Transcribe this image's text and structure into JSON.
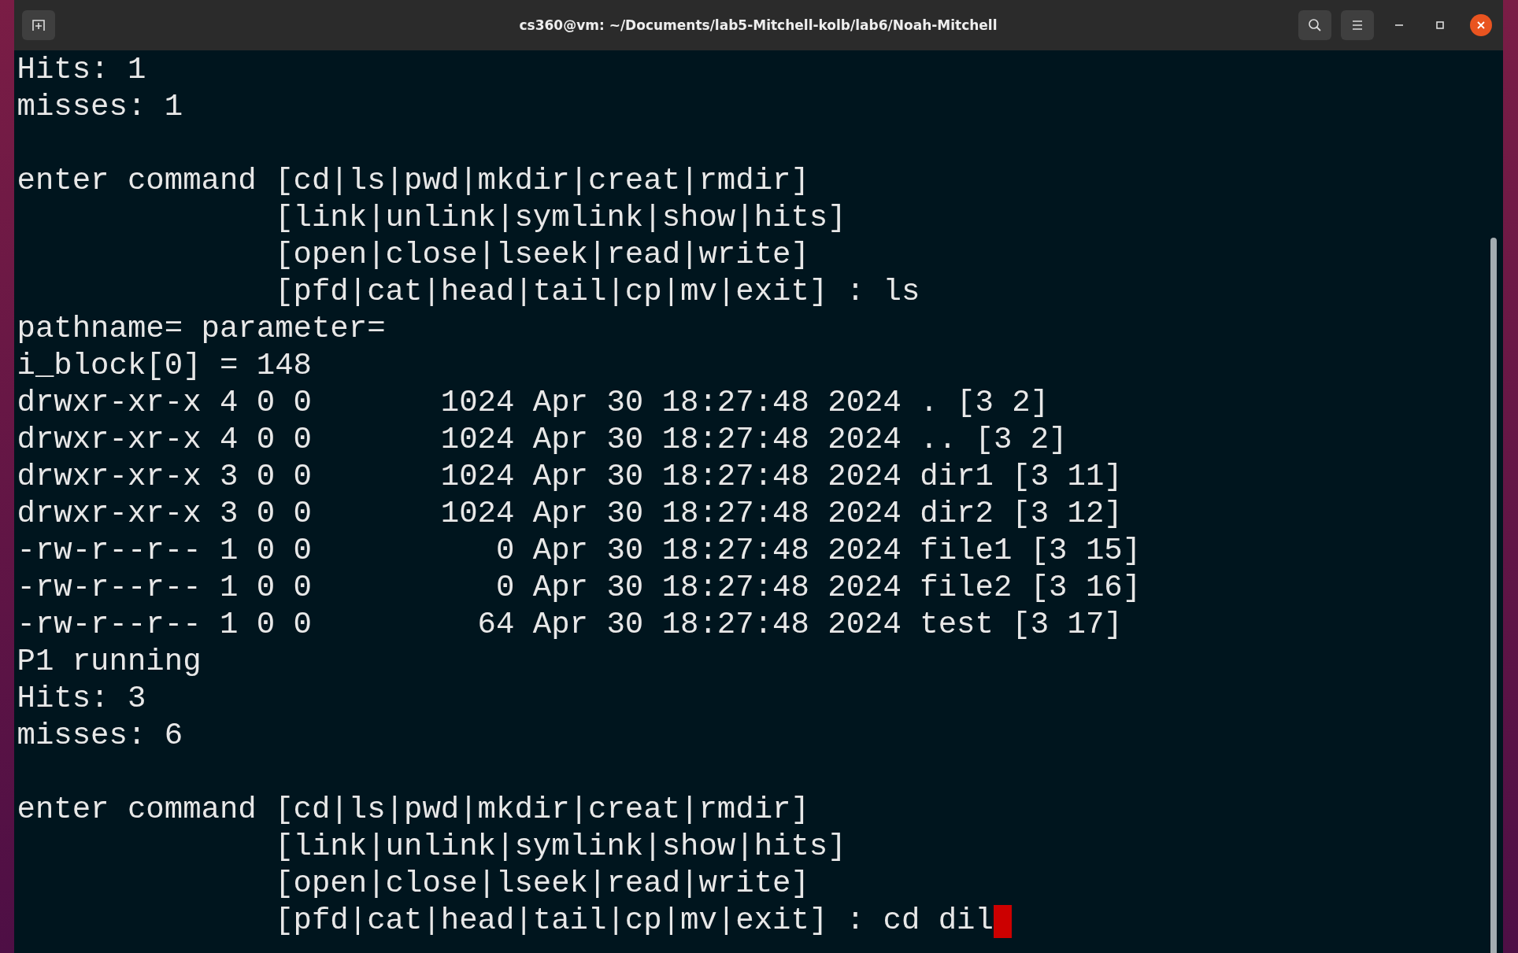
{
  "window": {
    "title": "cs360@vm: ~/Documents/lab5-Mitchell-kolb/lab6/Noah-Mitchell"
  },
  "terminal": {
    "lines": [
      {
        "kind": "text",
        "text": "Hits: 1"
      },
      {
        "kind": "text",
        "text": "misses: 1"
      },
      {
        "kind": "blank"
      },
      {
        "kind": "text",
        "text": "enter command [cd|ls|pwd|mkdir|creat|rmdir]"
      },
      {
        "kind": "text",
        "text": "              [link|unlink|symlink|show|hits]"
      },
      {
        "kind": "text",
        "text": "              [open|close|lseek|read|write]"
      },
      {
        "kind": "text",
        "text": "              [pfd|cat|head|tail|cp|mv|exit] : ls"
      },
      {
        "kind": "text",
        "text": "pathname= parameter="
      },
      {
        "kind": "text",
        "text": "i_block[0] = 148"
      },
      {
        "kind": "text",
        "text": "drwxr-xr-x 4 0 0       1024 Apr 30 18:27:48 2024 . [3 2]"
      },
      {
        "kind": "text",
        "text": "drwxr-xr-x 4 0 0       1024 Apr 30 18:27:48 2024 .. [3 2]"
      },
      {
        "kind": "text",
        "text": "drwxr-xr-x 3 0 0       1024 Apr 30 18:27:48 2024 dir1 [3 11]"
      },
      {
        "kind": "text",
        "text": "drwxr-xr-x 3 0 0       1024 Apr 30 18:27:48 2024 dir2 [3 12]"
      },
      {
        "kind": "text",
        "text": "-rw-r--r-- 1 0 0          0 Apr 30 18:27:48 2024 file1 [3 15]"
      },
      {
        "kind": "text",
        "text": "-rw-r--r-- 1 0 0          0 Apr 30 18:27:48 2024 file2 [3 16]"
      },
      {
        "kind": "text",
        "text": "-rw-r--r-- 1 0 0         64 Apr 30 18:27:48 2024 test [3 17]"
      },
      {
        "kind": "text",
        "text": "P1 running"
      },
      {
        "kind": "text",
        "text": "Hits: 3"
      },
      {
        "kind": "text",
        "text": "misses: 6"
      },
      {
        "kind": "blank"
      },
      {
        "kind": "text",
        "text": "enter command [cd|ls|pwd|mkdir|creat|rmdir]"
      },
      {
        "kind": "text",
        "text": "              [link|unlink|symlink|show|hits]"
      },
      {
        "kind": "text",
        "text": "              [open|close|lseek|read|write]"
      },
      {
        "kind": "text",
        "text": "              [pfd|cat|head|tail|cp|mv|exit] : cd dil"
      }
    ],
    "cursor_visible": true
  }
}
